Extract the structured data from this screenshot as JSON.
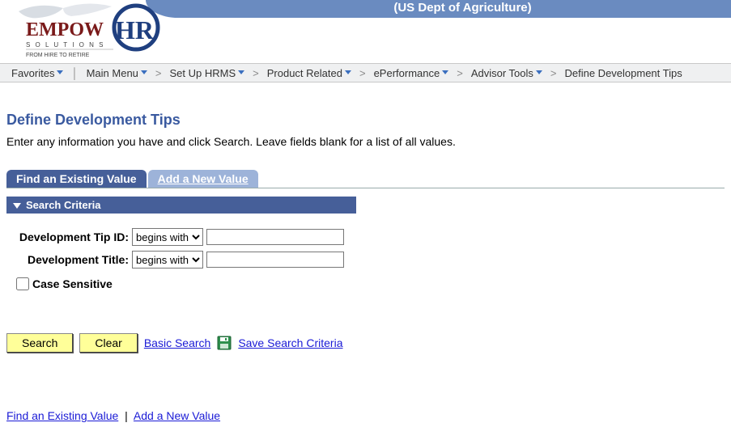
{
  "banner": {
    "org_title": "(US Dept of Agriculture)",
    "logo_top": "EMPOW",
    "logo_hr": "HR",
    "logo_sub1": "S O L U T I O N S",
    "logo_sub2": "FROM HIRE TO RETIRE"
  },
  "nav": {
    "favorites": "Favorites",
    "main_menu": "Main Menu",
    "setup_hrms": "Set Up HRMS",
    "product_related": "Product Related",
    "eperformance": "ePerformance",
    "advisor_tools": "Advisor Tools",
    "define_tips": "Define Development Tips"
  },
  "page": {
    "title": "Define Development Tips",
    "instructions": "Enter any information you have and click Search. Leave fields blank for a list of all values."
  },
  "tabs": {
    "find_existing": "Find an Existing Value",
    "add_new": "Add a New Value"
  },
  "criteria": {
    "header": "Search Criteria",
    "tip_id_label": "Development Tip ID:",
    "title_label": "Development Title:",
    "operator_selected": "begins with",
    "tip_id_value": "",
    "title_value": "",
    "case_sensitive_label": "Case Sensitive"
  },
  "actions": {
    "search": "Search",
    "clear": "Clear",
    "basic_search": "Basic Search",
    "save_criteria": "Save Search Criteria"
  },
  "bottom": {
    "find_existing": "Find an Existing Value",
    "add_new": "Add a New Value"
  }
}
